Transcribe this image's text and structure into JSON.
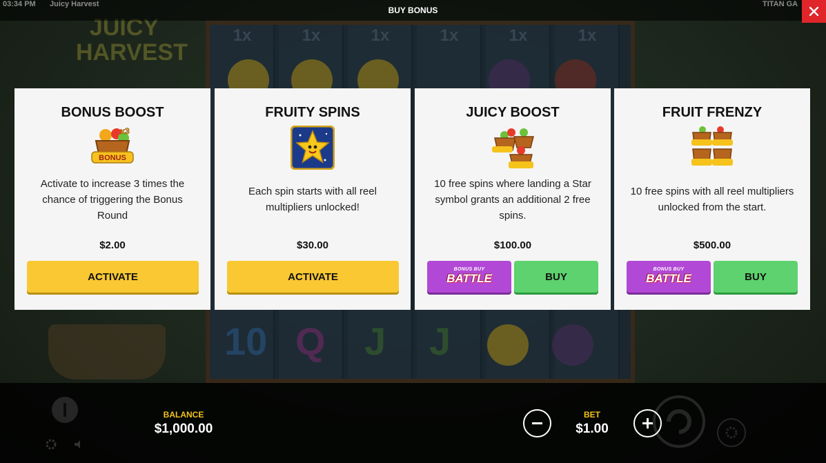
{
  "top_bar": {
    "time": "03:34 PM",
    "game_name": "Juicy Harvest",
    "title": "BUY BONUS",
    "provider": "TITAN GA",
    "close_icon": "close-icon",
    "close_color": "#e0262a"
  },
  "cards": [
    {
      "title": "BONUS BOOST",
      "icon": "bonus-basket-icon",
      "description": "Activate to increase 3 times the chance of triggering the Bonus Round",
      "price": "$2.00",
      "primary_label": "ACTIVATE"
    },
    {
      "title": "FRUITY SPINS",
      "icon": "star-icon",
      "description": "Each spin starts with all reel multipliers unlocked!",
      "price": "$30.00",
      "primary_label": "ACTIVATE"
    },
    {
      "title": "JUICY BOOST",
      "icon": "bonus-baskets-icon",
      "description": "10 free spins where landing a Star symbol grants an additional 2 free spins.",
      "price": "$100.00",
      "battle_top": "BONUS BUY",
      "battle_big": "BATTLE",
      "primary_label": "BUY"
    },
    {
      "title": "FRUIT FRENZY",
      "icon": "bonus-baskets-stack-icon",
      "description": "10 free spins with all reel multipliers unlocked from the start.",
      "price": "$500.00",
      "battle_top": "BONUS BUY",
      "battle_big": "BATTLE",
      "primary_label": "BUY"
    }
  ],
  "icon_labels": {
    "bonus": "BONUS",
    "multiplier": "x3"
  },
  "footer": {
    "balance_label": "BALANCE",
    "balance_value": "$1,000.00",
    "bet_label": "BET",
    "bet_value": "$1.00",
    "minus_icon": "minus-icon",
    "plus_icon": "plus-icon"
  },
  "colors": {
    "activate": "#f9c832",
    "buy": "#5dd26e",
    "battle": "#b249d6",
    "label_gold": "#f2c21a"
  }
}
